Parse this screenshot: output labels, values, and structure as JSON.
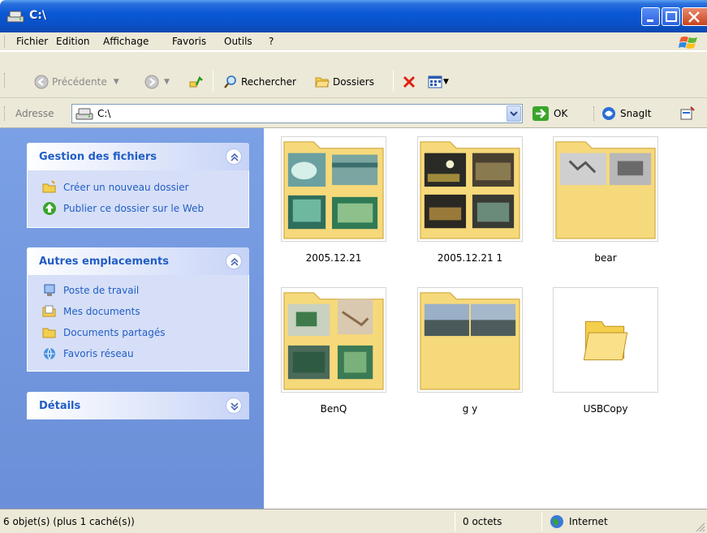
{
  "window": {
    "title": "C:\\"
  },
  "menu": [
    "Fichier",
    "Edition",
    "Affichage",
    "Favoris",
    "Outils",
    "?"
  ],
  "toolbar": {
    "back_label": "Précédente",
    "search_label": "Rechercher",
    "folders_label": "Dossiers"
  },
  "address": {
    "label": "Adresse",
    "value": "C:\\",
    "go_label": "OK",
    "snagit_label": "SnagIt"
  },
  "tasks": {
    "file_tasks": {
      "title": "Gestion des fichiers",
      "items": [
        "Créer un nouveau dossier",
        "Publier ce dossier sur le Web"
      ]
    },
    "other_places": {
      "title": "Autres emplacements",
      "items": [
        "Poste de travail",
        "Mes documents",
        "Documents partagés",
        "Favoris réseau"
      ]
    },
    "details": {
      "title": "Détails"
    }
  },
  "files": [
    {
      "name": "2005.12.21",
      "kind": "photo-folder"
    },
    {
      "name": "2005.12.21 1",
      "kind": "photo-folder"
    },
    {
      "name": "bear",
      "kind": "photo-folder"
    },
    {
      "name": "BenQ",
      "kind": "photo-folder"
    },
    {
      "name": "g y",
      "kind": "photo-folder"
    },
    {
      "name": "USBCopy",
      "kind": "empty-folder"
    }
  ],
  "status": {
    "objects": "6 objet(s) (plus 1 caché(s))",
    "size": "0 octets",
    "zone": "Internet"
  },
  "colors": {
    "titlebar": "#0b58d6",
    "taskpane": "#7ba0e5",
    "link": "#215dc6",
    "folder": "#f5d97a"
  }
}
